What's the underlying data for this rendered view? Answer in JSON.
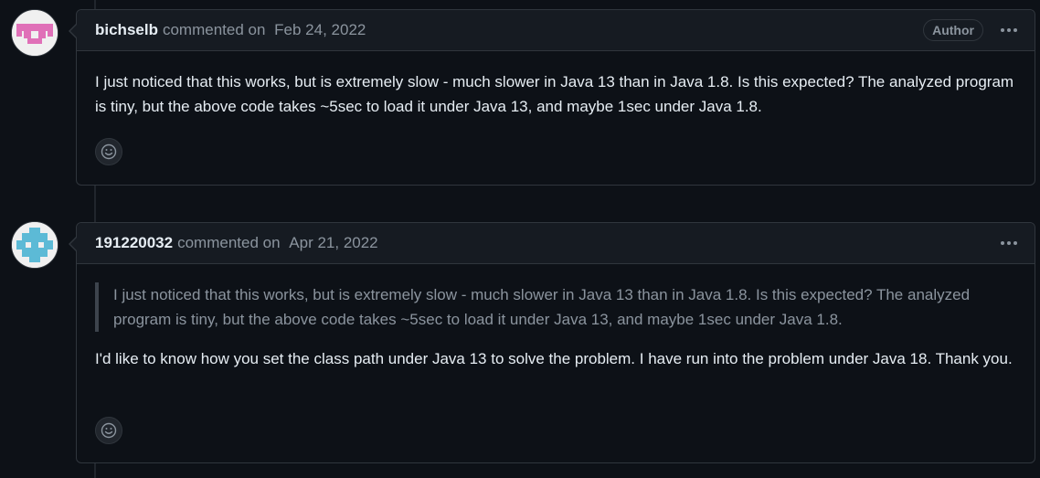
{
  "comments": [
    {
      "author": "bichselb",
      "action": "commented on",
      "date": "Feb 24, 2022",
      "badge": "Author",
      "avatar_color": "#e070b8",
      "body": "I just noticed that this works, but is extremely slow - much slower in Java 13 than in Java 1.8. Is this expected? The analyzed program is tiny, but the above code takes ~5sec to load it under Java 13, and maybe 1sec under Java 1.8."
    },
    {
      "author": "191220032",
      "action": "commented on",
      "date": "Apr 21, 2022",
      "avatar_color": "#5cbad6",
      "quote": "I just noticed that this works, but is extremely slow - much slower in Java 13 than in Java 1.8. Is this expected? The analyzed program is tiny, but the above code takes ~5sec to load it under Java 13, and maybe 1sec under Java 1.8.",
      "body": "I'd like to know how you set the class path under Java 13 to solve the problem. I have run into the problem under Java 18. Thank you."
    }
  ],
  "icons": {
    "menu": "kebab-horizontal-icon",
    "reaction": "smiley-icon"
  },
  "colors": {
    "background": "#0d1117",
    "header_background": "#161b22",
    "border": "#30363d",
    "muted_text": "#8b949e"
  }
}
